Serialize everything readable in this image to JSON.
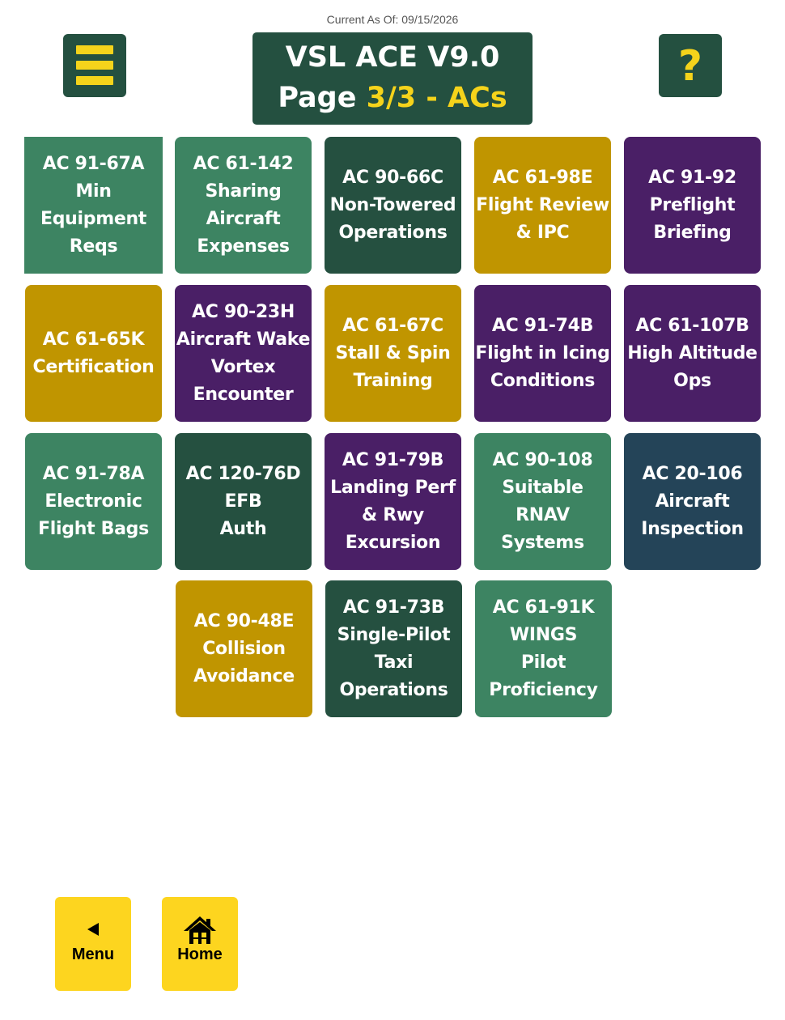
{
  "header": {
    "as_of": "Current As Of: 09/15/2026",
    "title_line1": "VSL ACE V9.0",
    "title_page_prefix": "Page ",
    "title_page_highlight": "3/3 - ACs",
    "help_label": "?"
  },
  "tiles": [
    {
      "lines": [
        "AC 91-67A",
        "Min",
        "Equipment",
        "Reqs"
      ],
      "color": "#3d8462"
    },
    {
      "lines": [
        "AC 61-142",
        "Sharing",
        "Aircraft",
        "Expenses"
      ],
      "color": "#3d8462"
    },
    {
      "lines": [
        "AC 90-66C",
        "Non-Towered",
        "Operations"
      ],
      "color": "#255040"
    },
    {
      "lines": [
        "AC 61-98E",
        "Flight Review",
        "& IPC"
      ],
      "color": "#c09500"
    },
    {
      "lines": [
        "AC 91-92",
        "Preflight",
        "Briefing"
      ],
      "color": "#4a1f66"
    },
    {
      "lines": [
        "AC 61-65K",
        "Certification"
      ],
      "color": "#c09500"
    },
    {
      "lines": [
        "AC 90-23H",
        "Aircraft Wake",
        "Vortex",
        "Encounter"
      ],
      "color": "#4a1f66"
    },
    {
      "lines": [
        "AC 61-67C",
        "Stall & Spin",
        "Training"
      ],
      "color": "#c09500"
    },
    {
      "lines": [
        "AC 91-74B",
        "Flight in Icing",
        "Conditions"
      ],
      "color": "#4a1f66"
    },
    {
      "lines": [
        "AC 61-107B",
        "High Altitude",
        "Ops"
      ],
      "color": "#4a1f66"
    },
    {
      "lines": [
        "AC 91-78A",
        "Electronic",
        "Flight Bags"
      ],
      "color": "#3d8462"
    },
    {
      "lines": [
        "AC 120-76D",
        "EFB",
        "Auth"
      ],
      "color": "#255040"
    },
    {
      "lines": [
        "AC 91-79B",
        "Landing Perf",
        "& Rwy",
        "Excursion"
      ],
      "color": "#4a1f66"
    },
    {
      "lines": [
        "AC 90-108",
        "Suitable",
        "RNAV",
        "Systems"
      ],
      "color": "#3d8462"
    },
    {
      "lines": [
        "AC 20-106",
        "Aircraft",
        "Inspection"
      ],
      "color": "#244458"
    },
    {
      "lines": [
        "AC 90-48E",
        "Collision",
        "Avoidance"
      ],
      "color": "#c09500"
    },
    {
      "lines": [
        "AC 91-73B",
        "Single-Pilot",
        "Taxi",
        "Operations"
      ],
      "color": "#255040"
    },
    {
      "lines": [
        "AC 61-91K",
        "WINGS",
        "Pilot",
        "Proficiency"
      ],
      "color": "#3d8462"
    }
  ],
  "footer": {
    "menu_label": "Menu",
    "menu_icon": "back-arrow-icon",
    "home_label": "Home",
    "home_icon": "house-icon"
  }
}
